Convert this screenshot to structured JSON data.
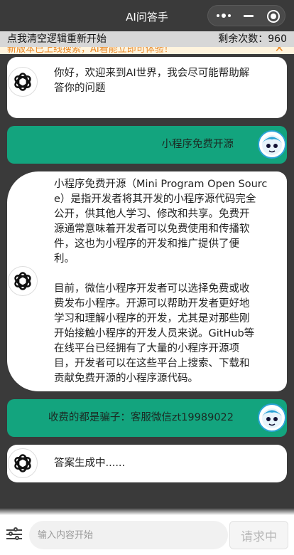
{
  "header": {
    "title": "AI问答手",
    "more_icon": "more-dots-icon",
    "minimize_icon": "minimize-icon",
    "close_icon": "target-close-icon"
  },
  "status": {
    "reset_label": "点我清空逻辑重新开始",
    "remaining_label": "剩余次数：960"
  },
  "notice": {
    "text": "新版本已上线搜索，AI看能立即可体验！",
    "close": "✕"
  },
  "messages": [
    {
      "role": "ai",
      "lines": [
        "你好，欢迎来到AI世界，我会尽可能帮助解",
        "答你的问题"
      ]
    },
    {
      "role": "user",
      "text": "小程序免费开源"
    },
    {
      "role": "ai",
      "lines": [
        "小程序免费开源（Mini Program Open Sourc",
        "e）是指开发者将其开发的小程序源代码完全",
        "公开，供其他人学习、修改和共享。免费开",
        "源通常意味着开发者可以免费使用和传播软",
        "件，这也为小程序的开发和推广提供了便",
        "利。",
        "",
        "目前，微信小程序开发者可以选择免费或收",
        "费发布小程序。开源可以帮助开发者更好地",
        "学习和理解小程序的开发，尤其是对那些刚",
        "开始接触小程序的开发人员来说。GitHub等",
        "在线平台已经拥有了大量的小程序开源项",
        "目，开发者可以在这些平台上搜索、下载和",
        "贡献免费开源的小程序源代码。"
      ]
    },
    {
      "role": "user",
      "text": "收费的都是骗子：客服微信zt19989022"
    },
    {
      "role": "ai",
      "lines": [
        "答案生成中......"
      ]
    }
  ],
  "input": {
    "placeholder": "输入内容开始",
    "send_label": "请求中",
    "settings_icon": "sliders-icon"
  },
  "colors": {
    "user_bubble": "#13a47e",
    "background": "#3a3a3a",
    "notice_text": "#e88a2a"
  }
}
